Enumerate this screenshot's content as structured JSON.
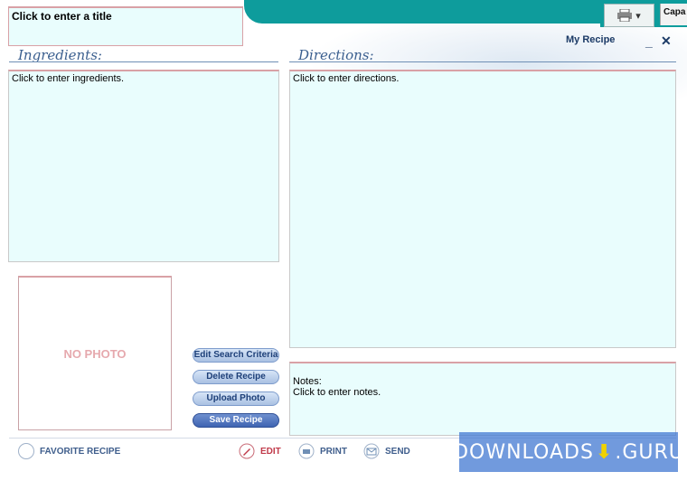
{
  "window": {
    "title_placeholder": "Click to enter a title",
    "brand": "My Recipe",
    "min_glyph": "_",
    "close_glyph": "✕"
  },
  "toolbar": {
    "capa_text": "Capa"
  },
  "ingredients": {
    "label": "Ingredients:",
    "placeholder": "Click to enter ingredients."
  },
  "directions": {
    "label": "Directions:",
    "placeholder": "Click to enter directions."
  },
  "notes": {
    "label": "Notes:",
    "placeholder": "Click to enter notes."
  },
  "photo": {
    "text": "NO PHOTO"
  },
  "buttons": {
    "edit_search": "Edit Search Criteria",
    "delete": "Delete Recipe",
    "upload": "Upload Photo",
    "save": "Save Recipe"
  },
  "bottom": {
    "favorite": "FAVORITE RECIPE",
    "edit": "EDIT",
    "print": "PRINT",
    "send": "SEND"
  },
  "watermark": {
    "left": "DOWNLOADS",
    "right": ".GURU"
  }
}
